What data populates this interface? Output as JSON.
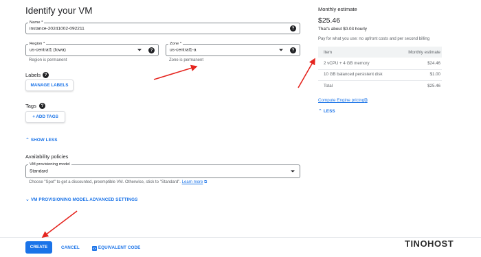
{
  "page": {
    "title": "Identify your VM"
  },
  "name_field": {
    "label": "Name *",
    "value": "instance-20241002-092211"
  },
  "region_field": {
    "label": "Region *",
    "value": "us-central1 (Iowa)",
    "hint": "Region is permanent"
  },
  "zone_field": {
    "label": "Zone *",
    "value": "us-central1-a",
    "hint": "Zone is permanent"
  },
  "labels": {
    "heading": "Labels",
    "button": "MANAGE LABELS"
  },
  "tags": {
    "heading": "Tags",
    "button": "+ ADD TAGS"
  },
  "show_less": "SHOW LESS",
  "availability": {
    "heading": "Availability policies",
    "model_label": "VM provisioning model",
    "model_value": "Standard",
    "hint_prefix": "Choose \"Spot\" to get a discounted, preemptible VM. Otherwise, stick to \"Standard\".",
    "learn_more": "Learn more"
  },
  "advanced": "VM PROVISIONING MODEL ADVANCED SETTINGS",
  "footer": {
    "create": "CREATE",
    "cancel": "CANCEL",
    "equivalent": "EQUIVALENT CODE"
  },
  "estimate": {
    "heading": "Monthly estimate",
    "price": "$25.46",
    "hourly": "That's about $0.03 hourly",
    "note": "Pay for what you use: no upfront costs and per second billing",
    "col_item": "Item",
    "col_estimate": "Monthly estimate",
    "rows": [
      {
        "item": "2 vCPU + 4 GB memory",
        "cost": "$24.46"
      },
      {
        "item": "10 GB balanced persistent disk",
        "cost": "$1.00"
      },
      {
        "item": "Total",
        "cost": "$25.46"
      }
    ],
    "pricing_link": "Compute Engine pricing",
    "less": "LESS"
  },
  "watermark": "TINOHOST",
  "colors": {
    "accent": "#1a73e8",
    "arrow": "#e5251f",
    "primary_button": "#1a73e8"
  }
}
